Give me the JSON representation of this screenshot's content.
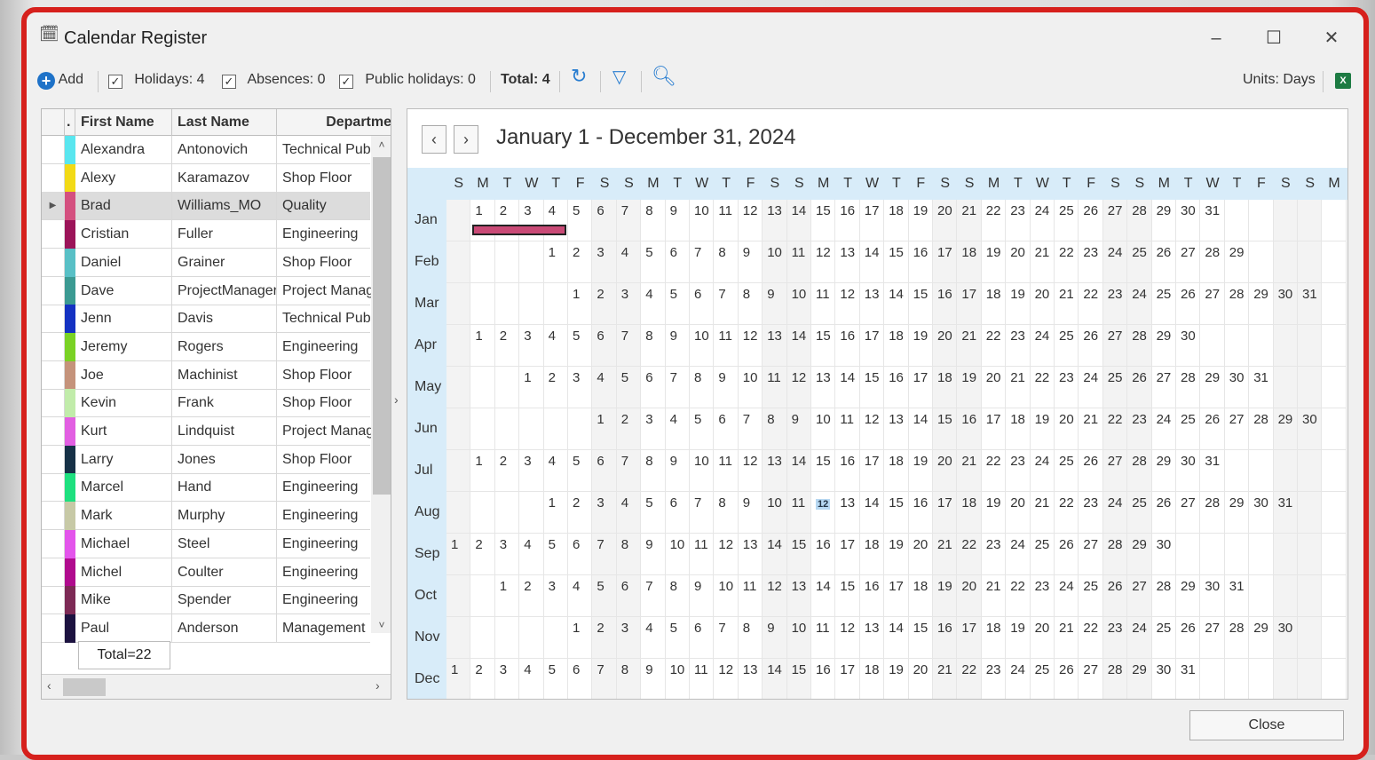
{
  "window": {
    "title": "Calendar Register",
    "units_label": "Units: Days"
  },
  "toolbar": {
    "add_label": "Add",
    "holidays_label": "Holidays: 4",
    "absences_label": "Absences: 0",
    "public_holidays_label": "Public holidays: 0",
    "total_label": "Total: 4"
  },
  "grid": {
    "columns": [
      "First Name",
      "Last Name",
      "Departme"
    ],
    "rows": [
      {
        "first": "Alexandra",
        "last": "Antonovich",
        "dept": "Technical Public",
        "color": "#59e6ef"
      },
      {
        "first": "Alexy",
        "last": "Karamazov",
        "dept": "Shop Floor",
        "color": "#f2da16"
      },
      {
        "first": "Brad",
        "last": "Williams_MO",
        "dept": "Quality",
        "color": "#d4507f"
      },
      {
        "first": "Cristian",
        "last": "Fuller",
        "dept": "Engineering",
        "color": "#9c1459"
      },
      {
        "first": "Daniel",
        "last": "Grainer",
        "dept": "Shop Floor",
        "color": "#58c0c6"
      },
      {
        "first": "Dave",
        "last": "ProjectManager",
        "dept": "Project Manage",
        "color": "#3b9a92"
      },
      {
        "first": "Jenn",
        "last": "Davis",
        "dept": "Technical Public",
        "color": "#1432c2"
      },
      {
        "first": "Jeremy",
        "last": "Rogers",
        "dept": "Engineering",
        "color": "#7ad225"
      },
      {
        "first": "Joe",
        "last": "Machinist",
        "dept": "Shop Floor",
        "color": "#c5937b"
      },
      {
        "first": "Kevin",
        "last": "Frank",
        "dept": "Shop Floor",
        "color": "#c1ecaa"
      },
      {
        "first": "Kurt",
        "last": "Lindquist",
        "dept": "Project Manage",
        "color": "#e25fe2"
      },
      {
        "first": "Larry",
        "last": "Jones",
        "dept": "Shop Floor",
        "color": "#163147"
      },
      {
        "first": "Marcel",
        "last": "Hand",
        "dept": "Engineering",
        "color": "#1ee07f"
      },
      {
        "first": "Mark",
        "last": "Murphy",
        "dept": "Engineering",
        "color": "#c7c9a6"
      },
      {
        "first": "Michael",
        "last": "Steel",
        "dept": "Engineering",
        "color": "#e355eb"
      },
      {
        "first": "Michel",
        "last": "Coulter",
        "dept": "Engineering",
        "color": "#b00b8e"
      },
      {
        "first": "Mike",
        "last": "Spender",
        "dept": "Engineering",
        "color": "#7d2a55"
      },
      {
        "first": "Paul",
        "last": "Anderson",
        "dept": "Management",
        "color": "#1c1240"
      }
    ],
    "total": "Total=22"
  },
  "calendar": {
    "range_title": "January 1 - December 31, 2024",
    "weekday_header": [
      "S",
      "M",
      "T",
      "W",
      "T",
      "F",
      "S",
      "S",
      "M",
      "T",
      "W",
      "T",
      "F",
      "S",
      "S",
      "M",
      "T",
      "W",
      "T",
      "F",
      "S",
      "S",
      "M",
      "T",
      "W",
      "T",
      "F",
      "S",
      "S",
      "M",
      "T",
      "W",
      "T",
      "F",
      "S",
      "S",
      "M"
    ],
    "months": [
      {
        "name": "Jan",
        "offset": 1,
        "days": 31
      },
      {
        "name": "Feb",
        "offset": 4,
        "days": 29
      },
      {
        "name": "Mar",
        "offset": 5,
        "days": 31
      },
      {
        "name": "Apr",
        "offset": 1,
        "days": 30
      },
      {
        "name": "May",
        "offset": 3,
        "days": 31
      },
      {
        "name": "Jun",
        "offset": 6,
        "days": 30
      },
      {
        "name": "Jul",
        "offset": 1,
        "days": 31
      },
      {
        "name": "Aug",
        "offset": 4,
        "days": 31
      },
      {
        "name": "Sep",
        "offset": 0,
        "days": 30
      },
      {
        "name": "Oct",
        "offset": 2,
        "days": 31
      },
      {
        "name": "Nov",
        "offset": 5,
        "days": 30
      },
      {
        "name": "Dec",
        "offset": 0,
        "days": 31
      }
    ],
    "today": {
      "month": "Aug",
      "day": 12
    },
    "holiday": {
      "month": "Jan",
      "from_day": 1,
      "to_day": 4,
      "color": "#c94a76"
    }
  },
  "close_label": "Close"
}
